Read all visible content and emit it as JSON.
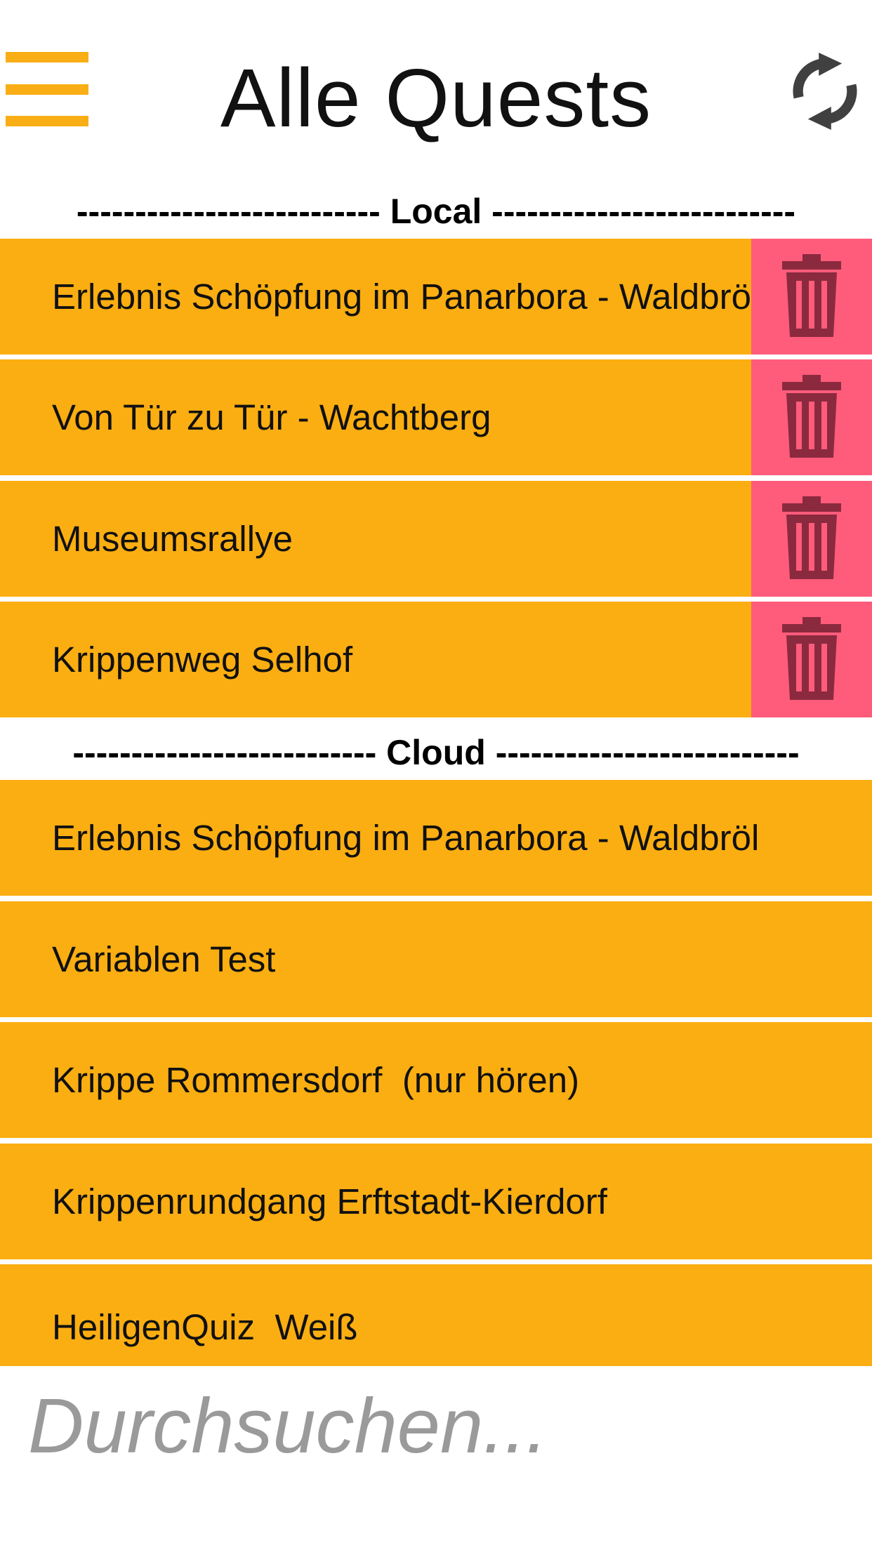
{
  "header": {
    "title": "Alle Quests",
    "menu_icon": "hamburger-menu-icon",
    "refresh_icon": "refresh-icon"
  },
  "sections": {
    "local": {
      "label": "-------------------------- Local --------------------------",
      "items": [
        {
          "label": "Erlebnis Schöpfung im Panarbora - Waldbröl"
        },
        {
          "label": "Von Tür zu Tür - Wachtberg"
        },
        {
          "label": "Museumsrallye"
        },
        {
          "label": "Krippenweg Selhof"
        }
      ]
    },
    "cloud": {
      "label": "-------------------------- Cloud --------------------------",
      "items": [
        {
          "label": "Erlebnis Schöpfung im Panarbora - Waldbröl"
        },
        {
          "label": "Variablen Test"
        },
        {
          "label": "Krippe Rommersdorf  (nur hören)"
        },
        {
          "label": "Krippenrundgang Erftstadt-Kierdorf"
        },
        {
          "label": "HeiligenQuiz  Weiß"
        }
      ]
    }
  },
  "search": {
    "placeholder": "Durchsuchen..."
  },
  "colors": {
    "accent": "#FBAE12",
    "delete": "#FF5C7C",
    "delete_icon": "#8B2A3E"
  }
}
